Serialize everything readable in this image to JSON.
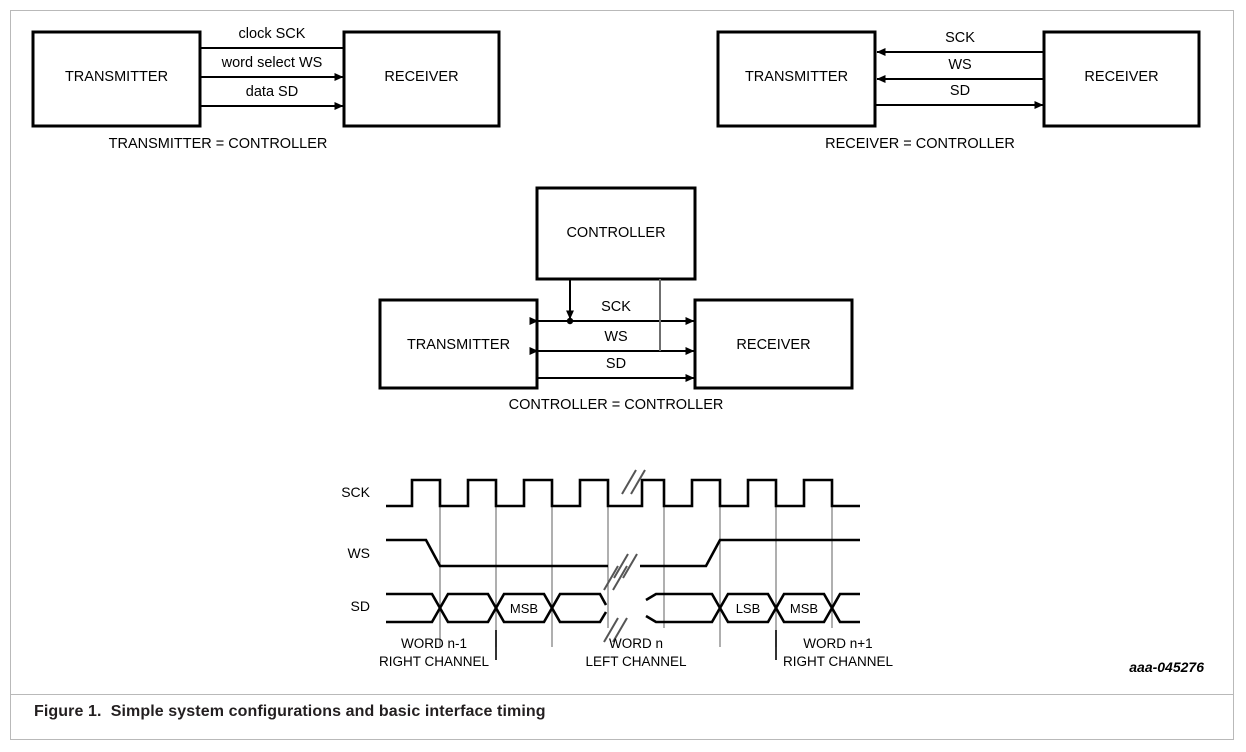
{
  "figure": {
    "caption_number": "Figure 1.",
    "caption_text": "Simple system configurations and basic interface timing",
    "art_number": "aaa-045276"
  },
  "diagrams": [
    {
      "id": "transmitter-is-controller",
      "left_box_label": "TRANSMITTER",
      "right_box_label": "RECEIVER",
      "config_label": "TRANSMITTER = CONTROLLER",
      "signals": [
        {
          "label": "clock SCK",
          "direction": "right"
        },
        {
          "label": "word select WS",
          "direction": "right"
        },
        {
          "label": "data SD",
          "direction": "right"
        }
      ]
    },
    {
      "id": "receiver-is-controller",
      "left_box_label": "TRANSMITTER",
      "right_box_label": "RECEIVER",
      "config_label": "RECEIVER = CONTROLLER",
      "signals": [
        {
          "label": "SCK",
          "direction": "left"
        },
        {
          "label": "WS",
          "direction": "left"
        },
        {
          "label": "SD",
          "direction": "right"
        }
      ]
    },
    {
      "id": "external-controller",
      "top_box_label": "CONTROLLER",
      "left_box_label": "TRANSMITTER",
      "right_box_label": "RECEIVER",
      "config_label": "CONTROLLER = CONTROLLER",
      "signals": [
        {
          "label": "SCK",
          "direction": "both"
        },
        {
          "label": "WS",
          "direction": "both"
        },
        {
          "label": "SD",
          "direction": "right"
        }
      ]
    }
  ],
  "timing": {
    "signal_names": [
      "SCK",
      "WS",
      "SD"
    ],
    "bit_markers": [
      "MSB",
      "LSB",
      "MSB"
    ],
    "words": [
      {
        "name": "WORD n-1",
        "channel": "RIGHT CHANNEL"
      },
      {
        "name": "WORD n",
        "channel": "LEFT CHANNEL"
      },
      {
        "name": "WORD n+1",
        "channel": "RIGHT CHANNEL"
      }
    ]
  },
  "colors": {
    "stroke": "#000000",
    "guide": "#808080",
    "frame": "#b9b9b9",
    "background": "#ffffff"
  }
}
